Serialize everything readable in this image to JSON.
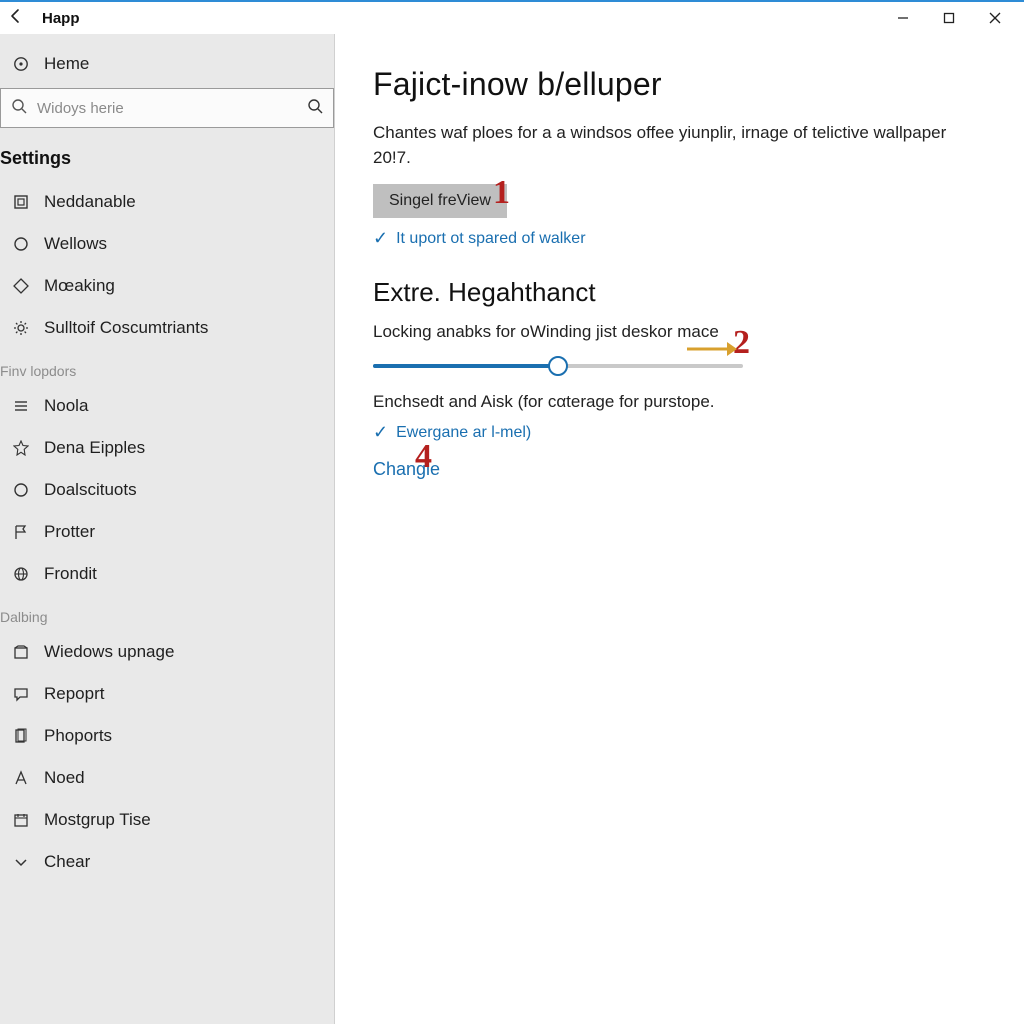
{
  "titlebar": {
    "title": "Happ"
  },
  "sidebar": {
    "home": "Heme",
    "search_placeholder": "Widoys herie",
    "settings_header": "Settings",
    "items_a": [
      {
        "label": "Neddanable"
      },
      {
        "label": "Wellows"
      },
      {
        "label": "Mœaking"
      },
      {
        "label": "Sulltoif Coscumtriants"
      }
    ],
    "group_b_label": "Finv lopdors",
    "items_b": [
      {
        "label": "Noola"
      },
      {
        "label": "Dena Eipples"
      },
      {
        "label": "Doalscituots"
      },
      {
        "label": "Protter"
      },
      {
        "label": "Frondit"
      }
    ],
    "group_c_label": "Dalbing",
    "items_c": [
      {
        "label": "Wiedows upnage"
      },
      {
        "label": "Repoprt"
      },
      {
        "label": "Phoports"
      },
      {
        "label": "Noed"
      },
      {
        "label": "Mostgrup Tise"
      },
      {
        "label": "Chear"
      }
    ]
  },
  "main": {
    "title": "Fajict-inow b/elluper",
    "description": "Chantes waf ploes for a a windsos offee yiunplir, irnage of telictive wallpaper 20!7.",
    "button_label": "Singel freView",
    "status1": "It uport ot spared of walker",
    "section2_title": "Extre. Hegahthanct",
    "slider_label": "Locking anabks for oWinding jist deskor mace",
    "slider_value_pct": 50,
    "body2": "Enchsedt and Aisk (for cαterage for purstope.",
    "status2": "Ewergane ar l-mel)",
    "change_link": "Changle"
  },
  "annotations": {
    "n1": "1",
    "n2": "2",
    "n4": "4"
  }
}
